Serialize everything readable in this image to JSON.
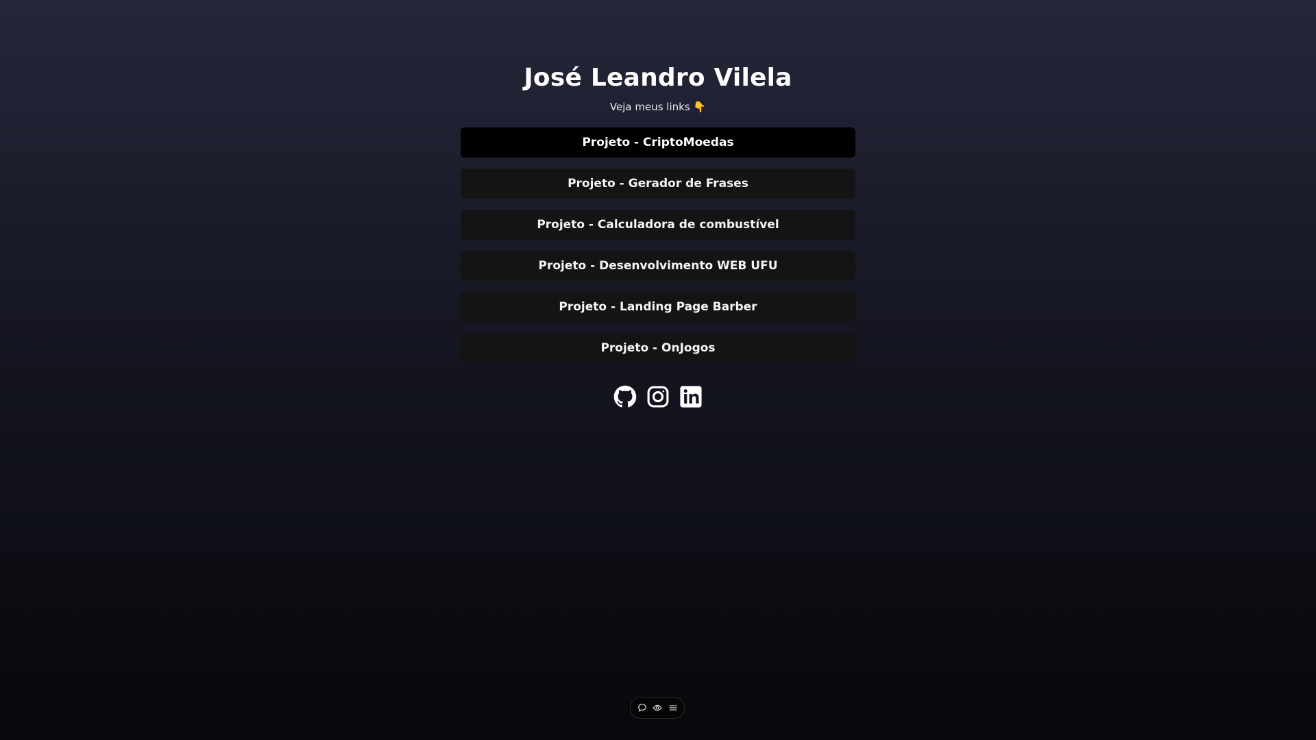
{
  "profile": {
    "name": "José Leandro Vilela",
    "subtitle": "Veja meus links 👇"
  },
  "links": [
    {
      "label": "Projeto - CriptoMoedas"
    },
    {
      "label": "Projeto - Gerador de Frases"
    },
    {
      "label": "Projeto - Calculadora de combustível"
    },
    {
      "label": "Projeto - Desenvolvimento WEB UFU"
    },
    {
      "label": "Projeto - Landing Page Barber"
    },
    {
      "label": "Projeto - OnJogos"
    }
  ],
  "socials": [
    {
      "icon": "github-icon"
    },
    {
      "icon": "instagram-icon"
    },
    {
      "icon": "linkedin-icon"
    }
  ],
  "toolbar": [
    {
      "icon": "comment-icon"
    },
    {
      "icon": "eye-icon"
    },
    {
      "icon": "menu-icon"
    }
  ],
  "colors": {
    "background_top": "#25263a",
    "background_bottom": "#07080b",
    "button_bg": "#141414",
    "button_active_bg": "#000000",
    "text": "#ffffff"
  }
}
